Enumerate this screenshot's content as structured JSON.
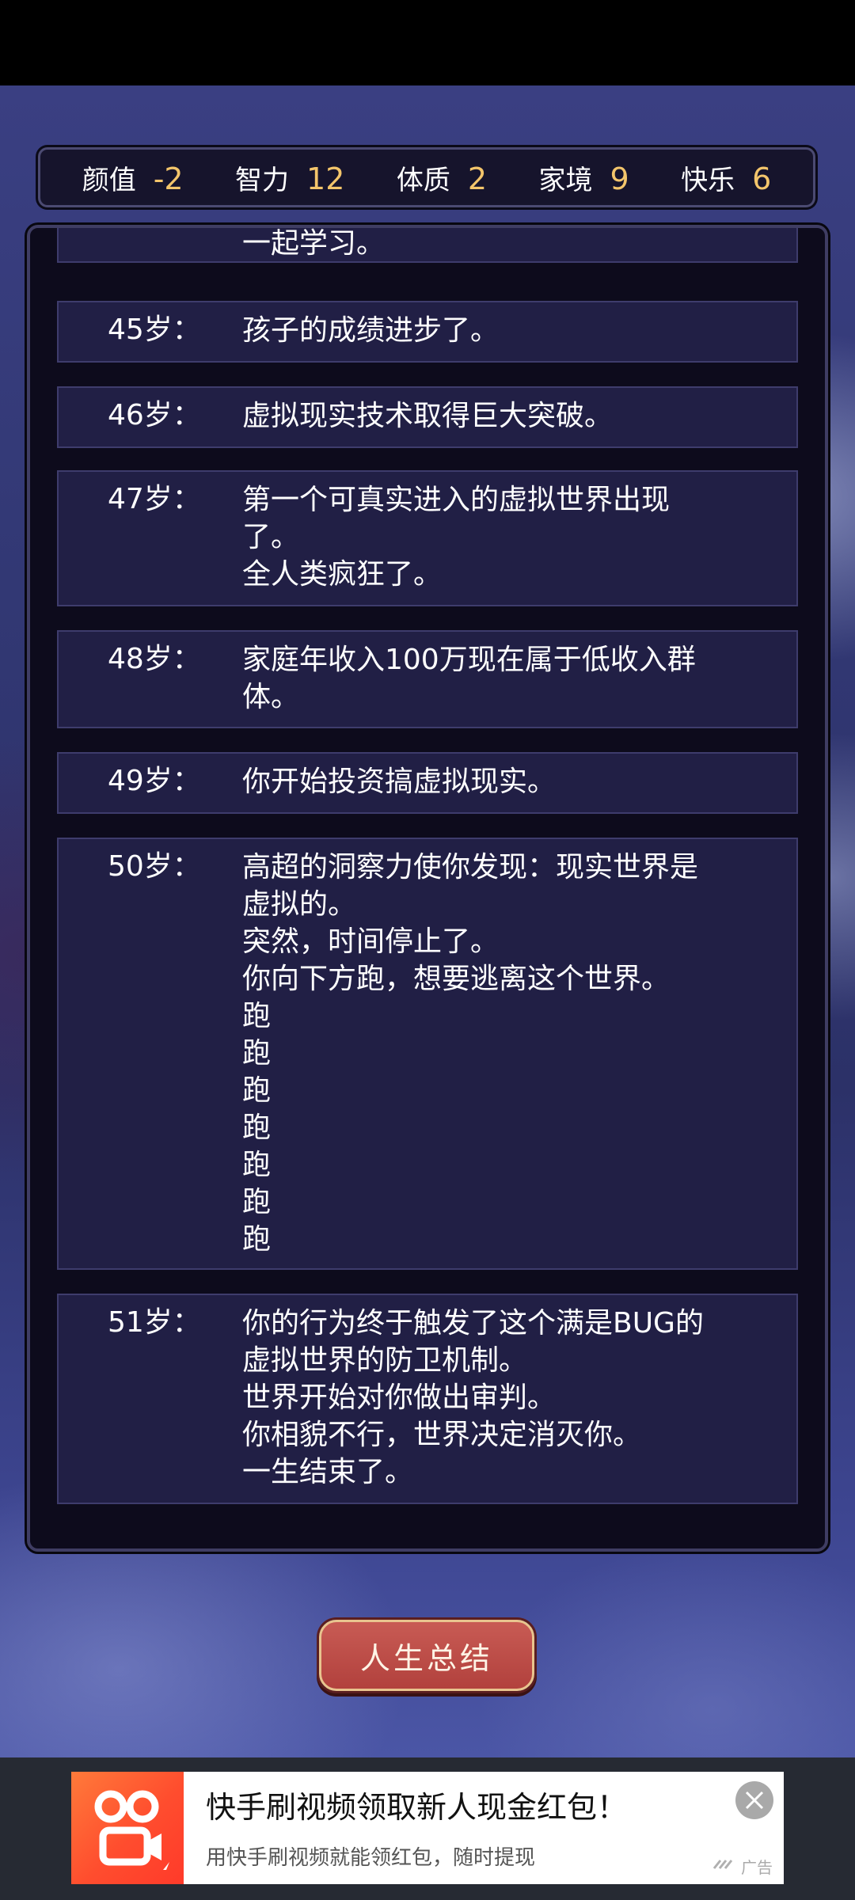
{
  "stats": [
    {
      "label": "颜值",
      "value": "-2"
    },
    {
      "label": "智力",
      "value": "12"
    },
    {
      "label": "体质",
      "value": "2"
    },
    {
      "label": "家境",
      "value": "9"
    },
    {
      "label": "快乐",
      "value": "6"
    }
  ],
  "events": [
    {
      "age": "",
      "lines": [
        "一起学习。"
      ]
    },
    {
      "age": "45岁：",
      "lines": [
        "孩子的成绩进步了。"
      ]
    },
    {
      "age": "46岁：",
      "lines": [
        "虚拟现实技术取得巨大突破。"
      ]
    },
    {
      "age": "47岁：",
      "lines": [
        "第一个可真实进入的虚拟世界出现",
        "了。",
        "全人类疯狂了。"
      ]
    },
    {
      "age": "48岁：",
      "lines": [
        "家庭年收入100万现在属于低收入群",
        "体。"
      ]
    },
    {
      "age": "49岁：",
      "lines": [
        "你开始投资搞虚拟现实。"
      ]
    },
    {
      "age": "50岁：",
      "lines": [
        "高超的洞察力使你发现：现实世界是",
        "虚拟的。",
        "突然，时间停止了。",
        "你向下方跑，想要逃离这个世界。",
        "跑",
        "跑",
        "跑",
        "跑",
        "跑",
        "跑",
        "跑"
      ]
    },
    {
      "age": "51岁：",
      "lines": [
        "你的行为终于触发了这个满是BUG的",
        "虚拟世界的防卫机制。",
        "世界开始对你做出审判。",
        "你相貌不行，世界决定消灭你。",
        "一生结束了。"
      ]
    }
  ],
  "summary_button": {
    "label": "人生总结"
  },
  "ad": {
    "title": "快手刷视频领取新人现金红包！",
    "subtitle": "用快手刷视频就能领红包，随时提现",
    "tag": "广告",
    "logo_icon": "kuaishou-logo-icon",
    "close_icon": "close-icon"
  }
}
